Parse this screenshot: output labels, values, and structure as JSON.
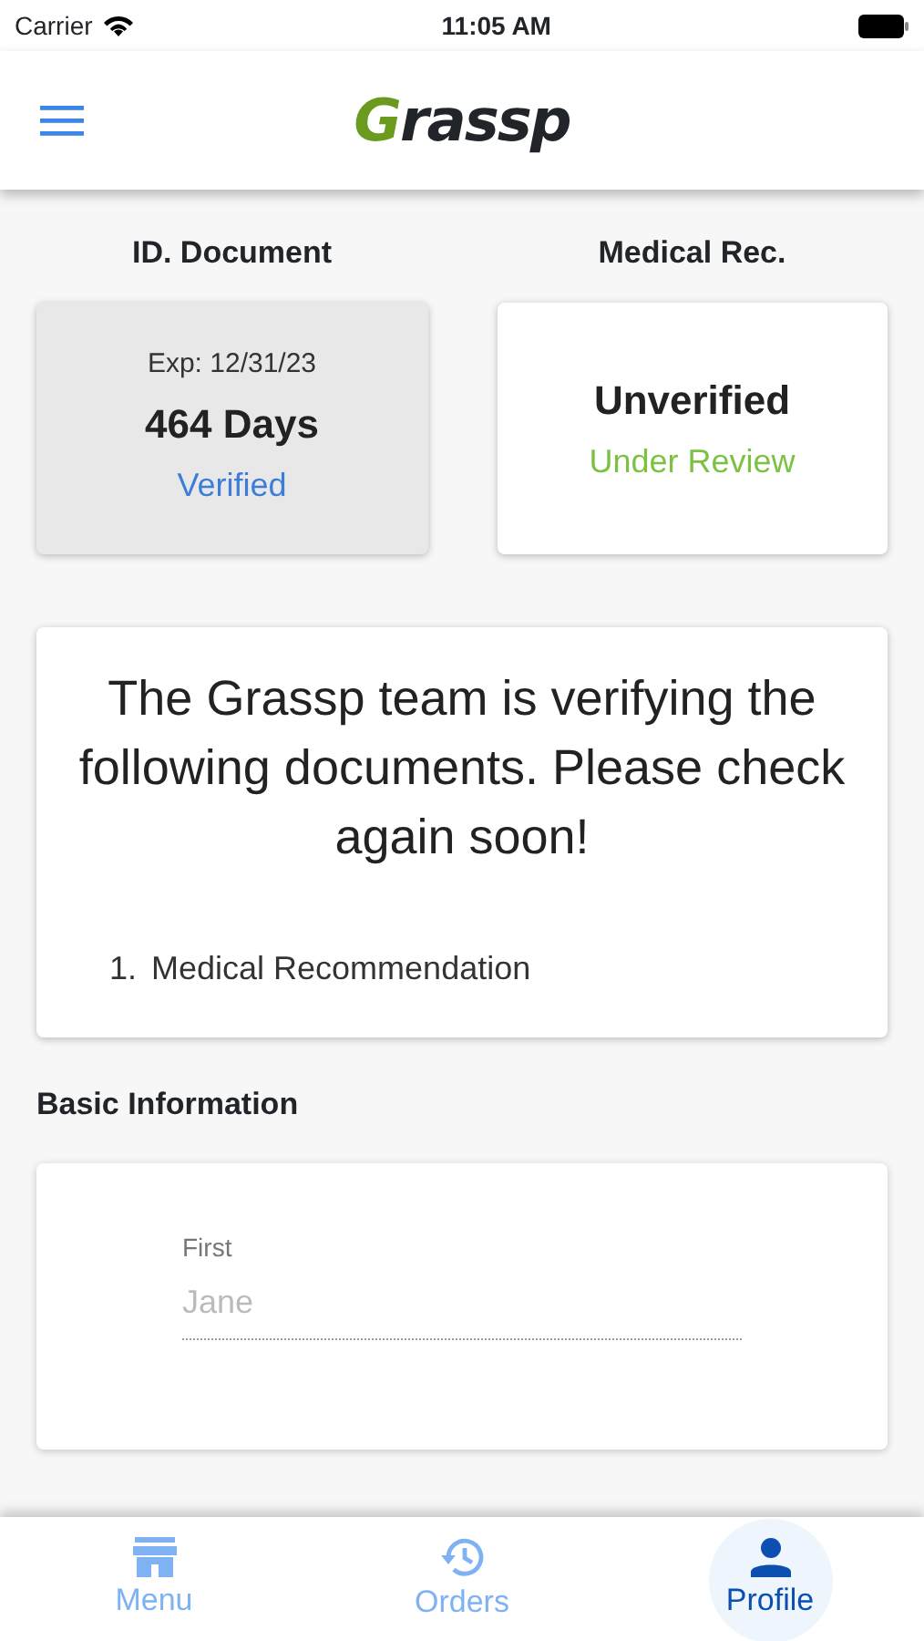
{
  "status_bar": {
    "carrier": "Carrier",
    "time": "11:05 AM"
  },
  "header": {
    "logo": {
      "initial": "G",
      "rest": "rassp"
    }
  },
  "documents": [
    {
      "heading": "ID. Document",
      "highlighted": true,
      "lines": [
        {
          "kind": "expiry",
          "text": "Exp: 12/31/23"
        },
        {
          "kind": "main",
          "text": "464 Days"
        },
        {
          "kind": "status",
          "text": "Verified",
          "color": "#3b7dd8"
        }
      ]
    },
    {
      "heading": "Medical Rec.",
      "highlighted": false,
      "lines": [
        {
          "kind": "main",
          "text": "Unverified"
        },
        {
          "kind": "status",
          "text": "Under Review",
          "color": "#7cc242"
        }
      ]
    }
  ],
  "notice": {
    "message": "The Grassp team is verifying the following documents. Please check again soon!",
    "items": [
      {
        "number": "1.",
        "text": "Medical Recommendation"
      }
    ]
  },
  "basic_information": {
    "title": "Basic Information",
    "fields": [
      {
        "label": "First",
        "placeholder": "Jane"
      }
    ]
  },
  "bottom_nav": [
    {
      "label": "Menu",
      "kind": "store",
      "selected": false
    },
    {
      "label": "Orders",
      "kind": "history",
      "selected": false
    },
    {
      "label": "Profile",
      "kind": "account",
      "selected": true
    }
  ]
}
